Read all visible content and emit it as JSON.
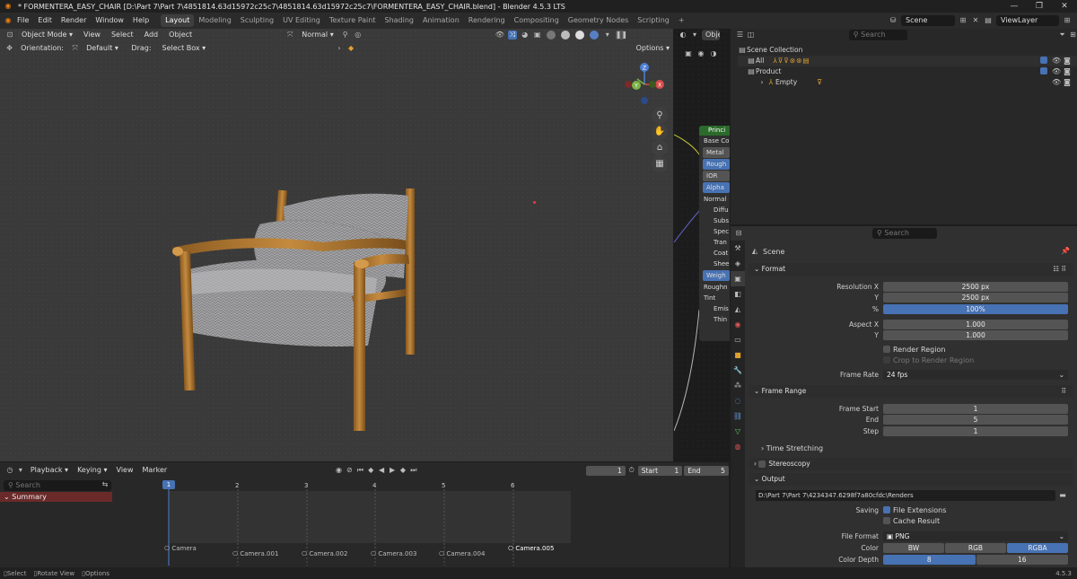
{
  "window": {
    "title": "* FORMENTERA_EASY_CHAIR [D:\\Part 7\\Part 7\\4851814.63d15972c25c7\\4851814.63d15972c25c7\\FORMENTERA_EASY_CHAIR.blend] - Blender 4.5.3 LTS",
    "controls": [
      "—",
      "❐",
      "✕"
    ]
  },
  "menu": [
    "File",
    "Edit",
    "Render",
    "Window",
    "Help"
  ],
  "workspaces": [
    "Layout",
    "Modeling",
    "Sculpting",
    "UV Editing",
    "Texture Paint",
    "Shading",
    "Animation",
    "Rendering",
    "Compositing",
    "Geometry Nodes",
    "Scripting",
    "+"
  ],
  "active_workspace": "Layout",
  "scene": "Scene",
  "view_layer": "ViewLayer",
  "viewport": {
    "mode": "Object Mode",
    "menus": [
      "View",
      "Select",
      "Add",
      "Object"
    ],
    "transform_orientation": "Normal",
    "orientation_label": "Orientation:",
    "orientation_value": "Default",
    "drag_label": "Drag:",
    "drag_value": "Select Box",
    "options": "Options",
    "gizmo": {
      "z": "Z",
      "x": "X",
      "y": "Y"
    },
    "accent": "#5680c2"
  },
  "node": {
    "title": "Princi",
    "rows": [
      "Base Co",
      "Metal",
      "Rough",
      "IOR",
      "Alpha",
      "Normal",
      "Diffu",
      "Subs",
      "Spec",
      "Tran",
      "Coat",
      "Shee",
      "Weigh",
      "Roughn",
      "Tint",
      "Emis",
      "Thin"
    ]
  },
  "node_header": "Obje",
  "outliner": {
    "search_placeholder": "Search",
    "rows": [
      {
        "label": "Scene Collection",
        "indent": 0
      },
      {
        "label": "All",
        "indent": 1
      },
      {
        "label": "Product",
        "indent": 1
      },
      {
        "label": "Empty",
        "indent": 2
      }
    ]
  },
  "properties": {
    "search_placeholder": "Search",
    "context": "Scene",
    "format": {
      "title": "Format",
      "res_x_label": "Resolution X",
      "res_x": "2500 px",
      "res_y_label": "Y",
      "res_y": "2500 px",
      "pct_label": "%",
      "pct": "100%",
      "aspect_x_label": "Aspect X",
      "aspect_x": "1.000",
      "aspect_y_label": "Y",
      "aspect_y": "1.000",
      "render_region": "Render Region",
      "crop": "Crop to Render Region",
      "frame_rate_label": "Frame Rate",
      "frame_rate": "24 fps"
    },
    "frame_range": {
      "title": "Frame Range",
      "start_label": "Frame Start",
      "start": "1",
      "end_label": "End",
      "end": "5",
      "step_label": "Step",
      "step": "1",
      "time_stretching": "Time Stretching"
    },
    "stereoscopy": "Stereoscopy",
    "output": {
      "title": "Output",
      "path": "D:\\Part 7\\Part 7\\4234347.6298f7a80cfdc\\Renders",
      "saving_label": "Saving",
      "file_ext": "File Extensions",
      "cache": "Cache Result",
      "file_format_label": "File Format",
      "file_format": "PNG",
      "color_label": "Color",
      "color_opts": [
        "BW",
        "RGB",
        "RGBA"
      ],
      "depth_label": "Color Depth",
      "depth_opts": [
        "8",
        "16"
      ]
    }
  },
  "timeline": {
    "menus": [
      "Playback",
      "Keying",
      "View",
      "Marker"
    ],
    "current_frame": "1",
    "start_label": "Start",
    "start": "1",
    "end_label": "End",
    "end": "5",
    "search_placeholder": "Search",
    "summary": "Summary",
    "frames": [
      "1",
      "2",
      "3",
      "4",
      "5",
      "6"
    ],
    "cameras": [
      "Camera",
      "Camera.001",
      "Camera.002",
      "Camera.003",
      "Camera.004",
      "Camera.005"
    ]
  },
  "status": {
    "select": "Select",
    "rotate": "Rotate View",
    "options": "Options",
    "version": "4.5.3"
  }
}
